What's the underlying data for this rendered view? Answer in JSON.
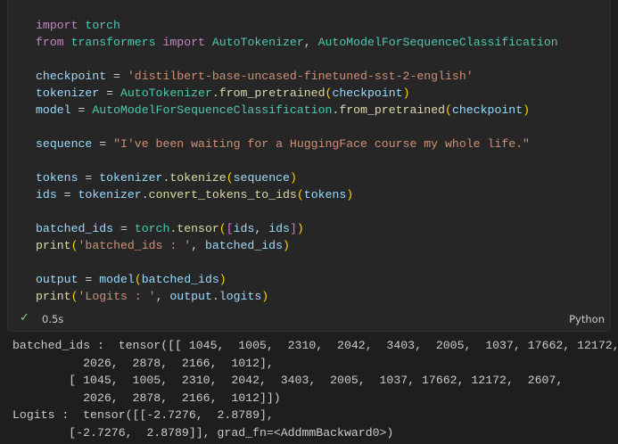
{
  "cell": {
    "code_lines": [
      "import torch",
      "from transformers import AutoTokenizer, AutoModelForSequenceClassification",
      "",
      "checkpoint = 'distilbert-base-uncased-finetuned-sst-2-english'",
      "tokenizer = AutoTokenizer.from_pretrained(checkpoint)",
      "model = AutoModelForSequenceClassification.from_pretrained(checkpoint)",
      "",
      "sequence = \"I've been waiting for a HuggingFace course my whole life.\"",
      "",
      "tokens = tokenizer.tokenize(sequence)",
      "ids = tokenizer.convert_tokens_to_ids(tokens)",
      "",
      "batched_ids = torch.tensor([ids, ids])",
      "print('batched_ids : ', batched_ids)",
      "",
      "output = model(batched_ids)",
      "print('Logits : ', output.logits)"
    ],
    "status": {
      "success_icon": "check-icon",
      "success_color": "#89d185",
      "execution_time": "0.5s",
      "language": "Python"
    }
  },
  "output": {
    "lines": [
      "batched_ids :  tensor([[ 1045,  1005,  2310,  2042,  3403,  2005,  1037, 17662, 12172,",
      "          2026,  2878,  2166,  1012],",
      "        [ 1045,  1005,  2310,  2042,  3403,  2005,  1037, 17662, 12172,  2607,",
      "          2026,  2878,  2166,  1012]])",
      "Logits :  tensor([[-2.7276,  2.8789],",
      "        [-2.7276,  2.8789]], grad_fn=<AddmmBackward0>)"
    ]
  },
  "colors": {
    "background": "#1e1e1e",
    "cell_background": "#262626",
    "keyword": "#c586c0",
    "variable": "#9cdcfe",
    "class": "#4ec9b0",
    "function": "#dcdcaa",
    "string": "#ce9178"
  }
}
